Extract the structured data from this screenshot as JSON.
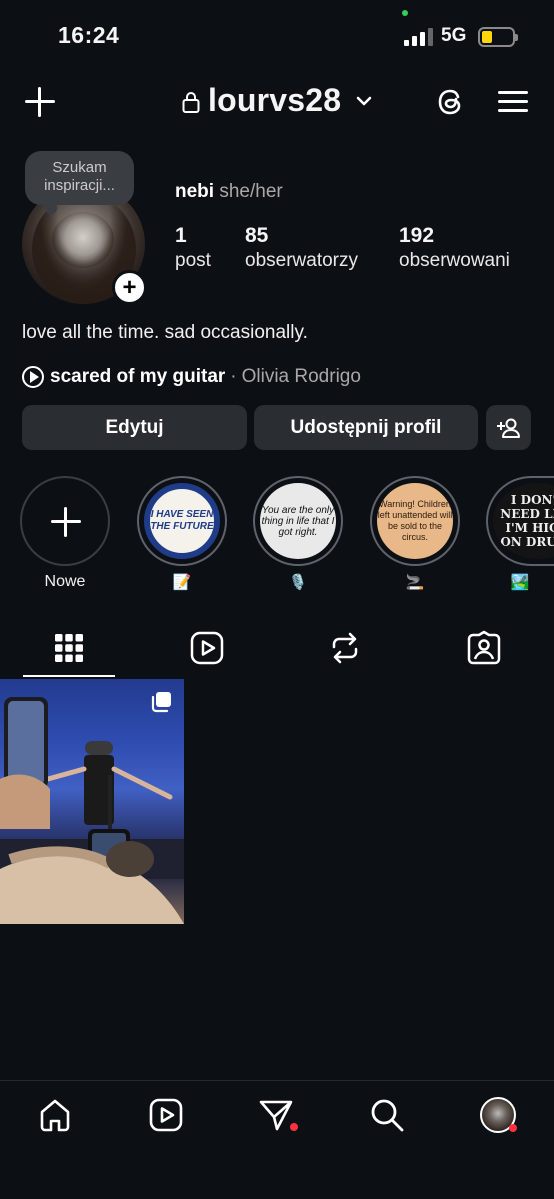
{
  "status_bar": {
    "time": "16:24",
    "network": "5G"
  },
  "header": {
    "username": "lourvs28"
  },
  "profile": {
    "note": "Szukam inspiracji...",
    "name": "nebi",
    "pronouns": "she/her",
    "stats": [
      {
        "count": "1",
        "label": "post"
      },
      {
        "count": "85",
        "label": "obserwatorzy"
      },
      {
        "count": "192",
        "label": "obserwowani"
      }
    ],
    "bio": "love all the time. sad occasionally.",
    "music": {
      "song": "scared of my guitar",
      "separator": "·",
      "artist": "Olivia Rodrigo"
    }
  },
  "buttons": {
    "edit": "Edytuj",
    "share": "Udostępnij profil"
  },
  "highlights": {
    "new_label": "Nowe",
    "items": [
      {
        "cover_text": "I HAVE SEEN THE FUTURE",
        "label_emoji": "📝"
      },
      {
        "cover_text": "You are the only thing in life that I got right.",
        "label_emoji": "🎙️"
      },
      {
        "cover_text": "Warning! Children left unattended will be sold to the circus.",
        "label_emoji": "🚬"
      },
      {
        "cover_text": "I DON'T NEED LIFE I'M HIGH ON DRUGS",
        "label_emoji": "🏞️"
      }
    ]
  },
  "tabs": [
    "grid-icon",
    "reels-icon",
    "reposts-icon",
    "tagged-icon"
  ],
  "bottom_nav": [
    "home-icon",
    "reels-icon",
    "send-icon",
    "search-icon",
    "profile-avatar"
  ]
}
